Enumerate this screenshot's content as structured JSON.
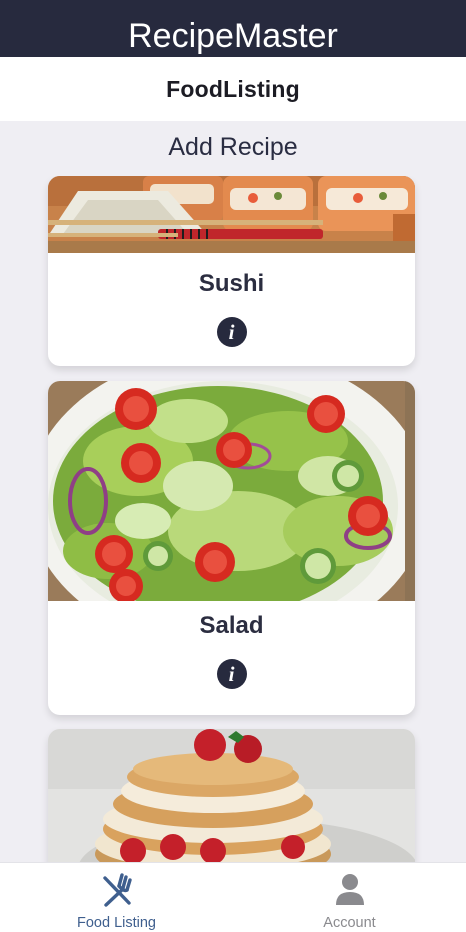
{
  "app": {
    "title": "RecipeMaster"
  },
  "nav": {
    "title": "FoodListing"
  },
  "actions": {
    "add_recipe": "Add Recipe"
  },
  "recipes": [
    {
      "name": "Sushi",
      "info_icon": "info-icon"
    },
    {
      "name": "Salad",
      "info_icon": "info-icon"
    },
    {
      "name": "",
      "info_icon": "info-icon"
    }
  ],
  "tabs": [
    {
      "label": "Food Listing",
      "icon": "fork-knife-icon",
      "active": true
    },
    {
      "label": "Account",
      "icon": "person-icon",
      "active": false
    }
  ],
  "colors": {
    "header_bg": "#272a3e",
    "active_tab": "#3f5f8e",
    "inactive_tab": "#8a8a8e",
    "background": "#efeef3"
  }
}
